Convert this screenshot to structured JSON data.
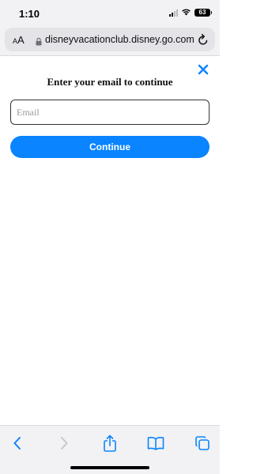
{
  "status_bar": {
    "time": "1:10",
    "battery": "63",
    "icons": [
      "signal-icon",
      "wifi-icon",
      "battery-icon"
    ]
  },
  "browser": {
    "text_size_label_small": "A",
    "text_size_label_large": "A",
    "url": "disneyvacationclub.disney.go.com",
    "icons": [
      "lock-icon",
      "reload-icon"
    ]
  },
  "page": {
    "heading": "Enter your email to continue",
    "email_placeholder": "Email",
    "email_value": "",
    "continue_label": "Continue",
    "close_icon": "close-icon"
  },
  "toolbar": {
    "icons": [
      "back-icon",
      "forward-icon",
      "share-icon",
      "bookmarks-icon",
      "tabs-icon"
    ]
  },
  "colors": {
    "accent": "#0a84ff",
    "chrome_background": "#f2f2f4",
    "url_pill": "#e3e3e8",
    "disabled_icon": "#c7c7cc"
  }
}
